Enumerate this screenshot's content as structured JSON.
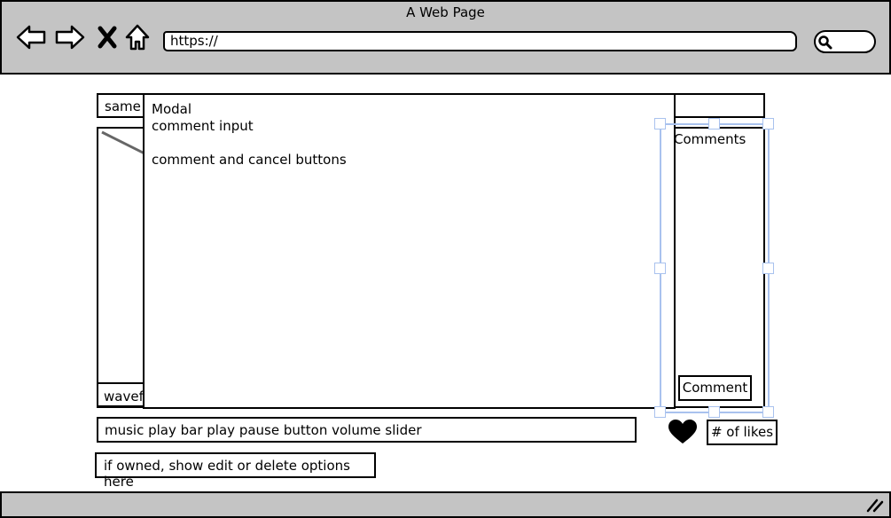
{
  "window": {
    "title": "A Web Page"
  },
  "address_bar": {
    "value": "https://"
  },
  "icons": [
    "back-icon",
    "forward-icon",
    "close-icon",
    "home-icon",
    "search-icon",
    "resize-grip-icon",
    "heart-icon"
  ],
  "content": {
    "tab_label": "same",
    "waveform_label": "wavefo",
    "comments_title": "Comments",
    "comment_button": "Comment",
    "playbar_label": "music play bar play pause button volume slider",
    "owned_label": "if owned, show edit or delete options here",
    "likes_label": "# of likes"
  },
  "modal": {
    "title": "Modal",
    "line1": "comment input",
    "line2": "comment and cancel buttons"
  }
}
